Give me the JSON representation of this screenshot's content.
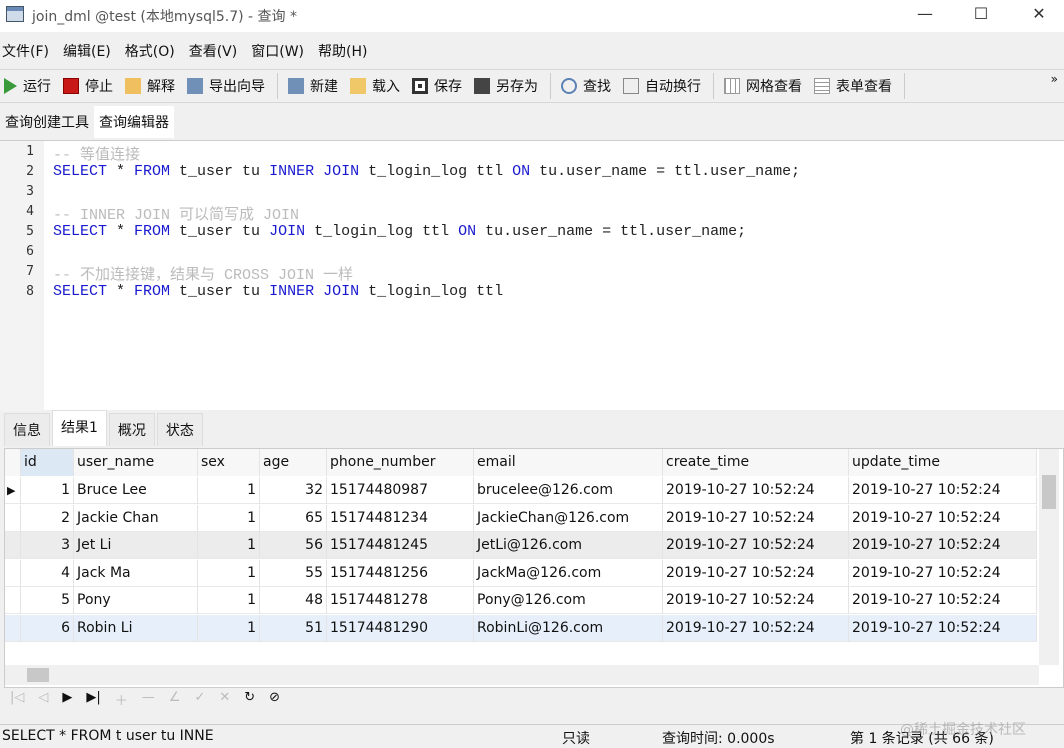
{
  "window": {
    "title": "join_dml @test (本地mysql5.7) - 查询 *",
    "minimize": "—",
    "maximize": "☐",
    "close": "✕"
  },
  "menu": [
    "文件(F)",
    "编辑(E)",
    "格式(O)",
    "查看(V)",
    "窗口(W)",
    "帮助(H)"
  ],
  "toolbar": {
    "groups": [
      [
        {
          "label": "运行",
          "icon": "play-icon"
        },
        {
          "label": "停止",
          "icon": "stop-icon"
        },
        {
          "label": "解释",
          "icon": "explain-icon"
        },
        {
          "label": "导出向导",
          "icon": "export-icon"
        }
      ],
      [
        {
          "label": "新建",
          "icon": "new-icon"
        },
        {
          "label": "载入",
          "icon": "folder-icon"
        },
        {
          "label": "保存",
          "icon": "save-icon"
        },
        {
          "label": "另存为",
          "icon": "save-as-icon"
        }
      ],
      [
        {
          "label": "查找",
          "icon": "search-icon"
        },
        {
          "label": "自动换行",
          "icon": "wrap-icon"
        }
      ],
      [
        {
          "label": "网格查看",
          "icon": "grid-icon"
        },
        {
          "label": "表单查看",
          "icon": "form-icon"
        }
      ]
    ],
    "overflow": "»"
  },
  "subtabs": [
    "查询创建工具",
    "查询编辑器"
  ],
  "editor": {
    "lines": [
      [
        {
          "t": "-- 等值连接",
          "c": "cm"
        }
      ],
      [
        {
          "t": "SELECT",
          "c": "kw"
        },
        {
          "t": " * "
        },
        {
          "t": "FROM",
          "c": "kw"
        },
        {
          "t": " t_user tu "
        },
        {
          "t": "INNER JOIN",
          "c": "kw"
        },
        {
          "t": " t_login_log ttl "
        },
        {
          "t": "ON",
          "c": "kw"
        },
        {
          "t": " tu.user_name = ttl.user_name;"
        }
      ],
      [],
      [
        {
          "t": "-- INNER JOIN 可以简写成 JOIN",
          "c": "cm"
        }
      ],
      [
        {
          "t": "SELECT",
          "c": "kw"
        },
        {
          "t": " * "
        },
        {
          "t": "FROM",
          "c": "kw"
        },
        {
          "t": " t_user tu "
        },
        {
          "t": "JOIN",
          "c": "kw"
        },
        {
          "t": " t_login_log ttl "
        },
        {
          "t": "ON",
          "c": "kw"
        },
        {
          "t": " tu.user_name = ttl.user_name;"
        }
      ],
      [],
      [
        {
          "t": "-- 不加连接键，结果与 CROSS JOIN 一样",
          "c": "cm"
        }
      ],
      [
        {
          "t": "SELECT",
          "c": "kw"
        },
        {
          "t": " * "
        },
        {
          "t": "FROM",
          "c": "kw"
        },
        {
          "t": " t_user tu "
        },
        {
          "t": "INNER JOIN",
          "c": "kw"
        },
        {
          "t": " t_login_log ttl"
        }
      ]
    ]
  },
  "result_tabs": [
    "信息",
    "结果1",
    "概况",
    "状态"
  ],
  "grid": {
    "columns": [
      "id",
      "user_name",
      "sex",
      "age",
      "phone_number",
      "email",
      "create_time",
      "update_time"
    ],
    "rows": [
      [
        "1",
        "Bruce Lee",
        "1",
        "32",
        "15174480987",
        "brucelee@126.com",
        "2019-10-27 10:52:24",
        "2019-10-27 10:52:24"
      ],
      [
        "2",
        "Jackie Chan",
        "1",
        "65",
        "15174481234",
        "JackieChan@126.com",
        "2019-10-27 10:52:24",
        "2019-10-27 10:52:24"
      ],
      [
        "3",
        "Jet Li",
        "1",
        "56",
        "15174481245",
        "JetLi@126.com",
        "2019-10-27 10:52:24",
        "2019-10-27 10:52:24"
      ],
      [
        "4",
        "Jack Ma",
        "1",
        "55",
        "15174481256",
        "JackMa@126.com",
        "2019-10-27 10:52:24",
        "2019-10-27 10:52:24"
      ],
      [
        "5",
        "Pony",
        "1",
        "48",
        "15174481278",
        "Pony@126.com",
        "2019-10-27 10:52:24",
        "2019-10-27 10:52:24"
      ],
      [
        "6",
        "Robin Li",
        "1",
        "51",
        "15174481290",
        "RobinLi@126.com",
        "2019-10-27 10:52:24",
        "2019-10-27 10:52:24"
      ]
    ]
  },
  "status": {
    "sql": "SELECT * FROM t user tu INNE",
    "mode": "只读",
    "query_time": "查询时间: 0.000s",
    "record": "第 1 条记录 (共 66 条)",
    "watermark": "@稀土掘金技术社区"
  }
}
